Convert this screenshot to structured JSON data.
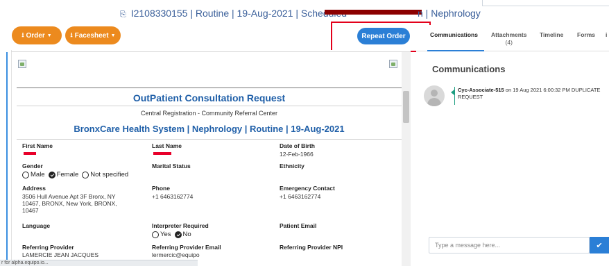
{
  "header": {
    "icon": "copy-icon",
    "order_info": "I2108330155  |  Routine  |  19-Aug-2021  |  Scheduled",
    "specialty_suffix": "n | Nephrology"
  },
  "toolbar": {
    "order_label": "Order",
    "facesheet_label": "Facesheet",
    "repeat_order_label": "Repeat Order"
  },
  "document": {
    "title": "OutPatient Consultation Request",
    "subtitle": "Central Registration - Community Referral Center",
    "heading": "BronxCare Health System | Nephrology | Routine | 19-Aug-2021",
    "fields": {
      "first_name_label": "First Name",
      "last_name_label": "Last Name",
      "dob_label": "Date of Birth",
      "dob_value": "12-Feb-1966",
      "gender_label": "Gender",
      "gender_options": [
        "Male",
        "Female",
        "Not specified"
      ],
      "gender_selected": "Female",
      "marital_label": "Marital Status",
      "ethnicity_label": "Ethnicity",
      "address_label": "Address",
      "address_value": "3506 Hull Avenue Apt 3F Bronx, NY 10467, BRONX, New York, BRONX, 10467",
      "phone_label": "Phone",
      "phone_value": "+1 6463162774",
      "emergency_label": "Emergency Contact",
      "emergency_value": "+1 6463162774",
      "language_label": "Language",
      "interpreter_label": "Interpreter Required",
      "interpreter_options": [
        "Yes",
        "No"
      ],
      "interpreter_selected": "No",
      "patient_email_label": "Patient Email",
      "ref_provider_label": "Referring Provider",
      "ref_provider_value": "LAMERCIE JEAN JACQUES",
      "ref_email_label": "Referring Provider Email",
      "ref_email_value": "lermercic@equipo",
      "ref_npi_label": "Referring Provider NPI"
    }
  },
  "status_bar": "r for alpha.equipo.io...",
  "right_panel": {
    "tabs": [
      {
        "label": "Communications"
      },
      {
        "label": "Attachments",
        "count": "(4)"
      },
      {
        "label": "Timeline"
      },
      {
        "label": "Forms"
      },
      {
        "label": "i"
      }
    ],
    "communications_title": "Communications",
    "message": {
      "author": "Cyc-Associate-515",
      "text": " on 19 Aug 2021 6:00:32 PM DUPLICATE REQUEST"
    },
    "input_placeholder": "Type a message here...",
    "send_icon": "check-icon"
  },
  "colors": {
    "accent_orange": "#ec8a1e",
    "accent_blue": "#2b7fd6",
    "title_blue": "#1f5fa8",
    "highlight_red": "#e3001b"
  }
}
